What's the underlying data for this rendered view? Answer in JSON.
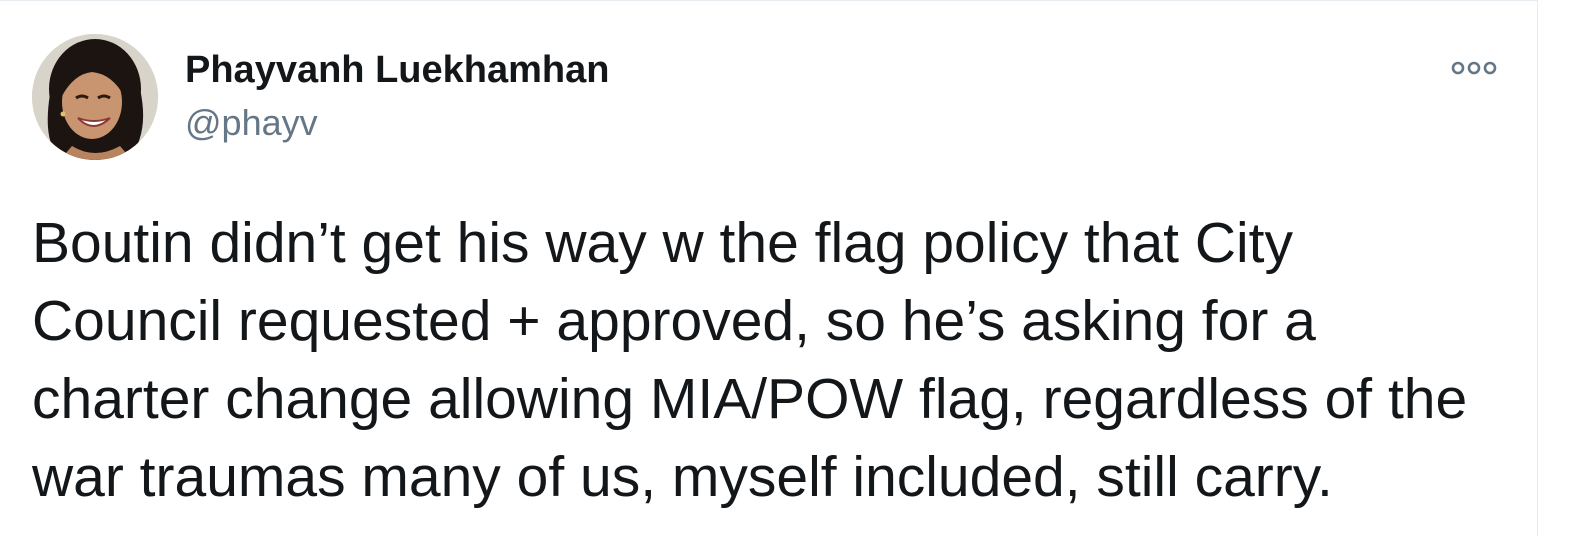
{
  "author": {
    "display_name": "Phayvanh Luekhamhan",
    "handle": "@phayv"
  },
  "tweet": {
    "lines": [
      "Boutin didn’t get his way w the flag policy that City",
      "Council requested + approved, so he’s asking for a",
      "charter change allowing MIA/POW flag, regardless of the",
      "war traumas many of us, myself included, still carry."
    ]
  },
  "icons": {
    "more": "more-options-icon",
    "avatar": "profile-photo"
  },
  "colors": {
    "text": "#14171a",
    "secondary": "#657786",
    "border": "#e6ecf0"
  }
}
